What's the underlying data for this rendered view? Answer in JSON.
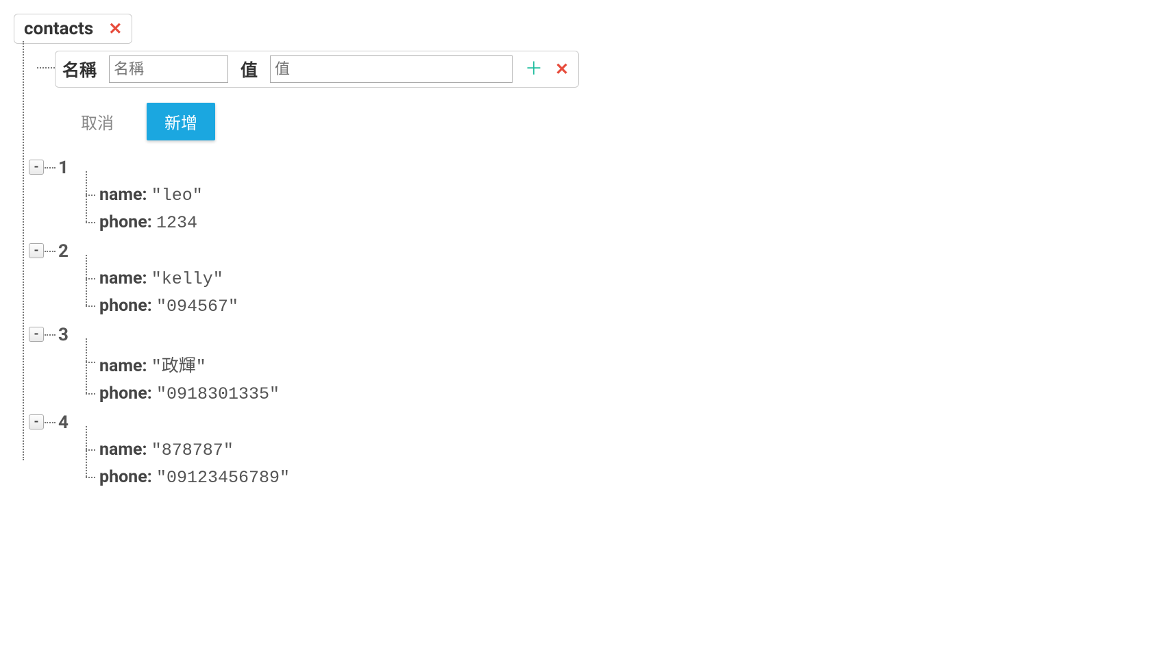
{
  "root": {
    "label": "contacts"
  },
  "form": {
    "name_label": "名稱",
    "name_placeholder": "名稱",
    "value_label": "值",
    "value_placeholder": "值",
    "cancel_label": "取消",
    "add_label": "新增"
  },
  "items": [
    {
      "index": "1",
      "fields": [
        {
          "key": "name:",
          "value": "\"leo\""
        },
        {
          "key": "phone:",
          "value": "1234"
        }
      ]
    },
    {
      "index": "2",
      "fields": [
        {
          "key": "name:",
          "value": "\"kelly\""
        },
        {
          "key": "phone:",
          "value": "\"094567\""
        }
      ]
    },
    {
      "index": "3",
      "fields": [
        {
          "key": "name:",
          "value": "\"政輝\""
        },
        {
          "key": "phone:",
          "value": "\"0918301335\""
        }
      ]
    },
    {
      "index": "4",
      "fields": [
        {
          "key": "name:",
          "value": "\"878787\""
        },
        {
          "key": "phone:",
          "value": "\"09123456789\""
        }
      ]
    }
  ]
}
